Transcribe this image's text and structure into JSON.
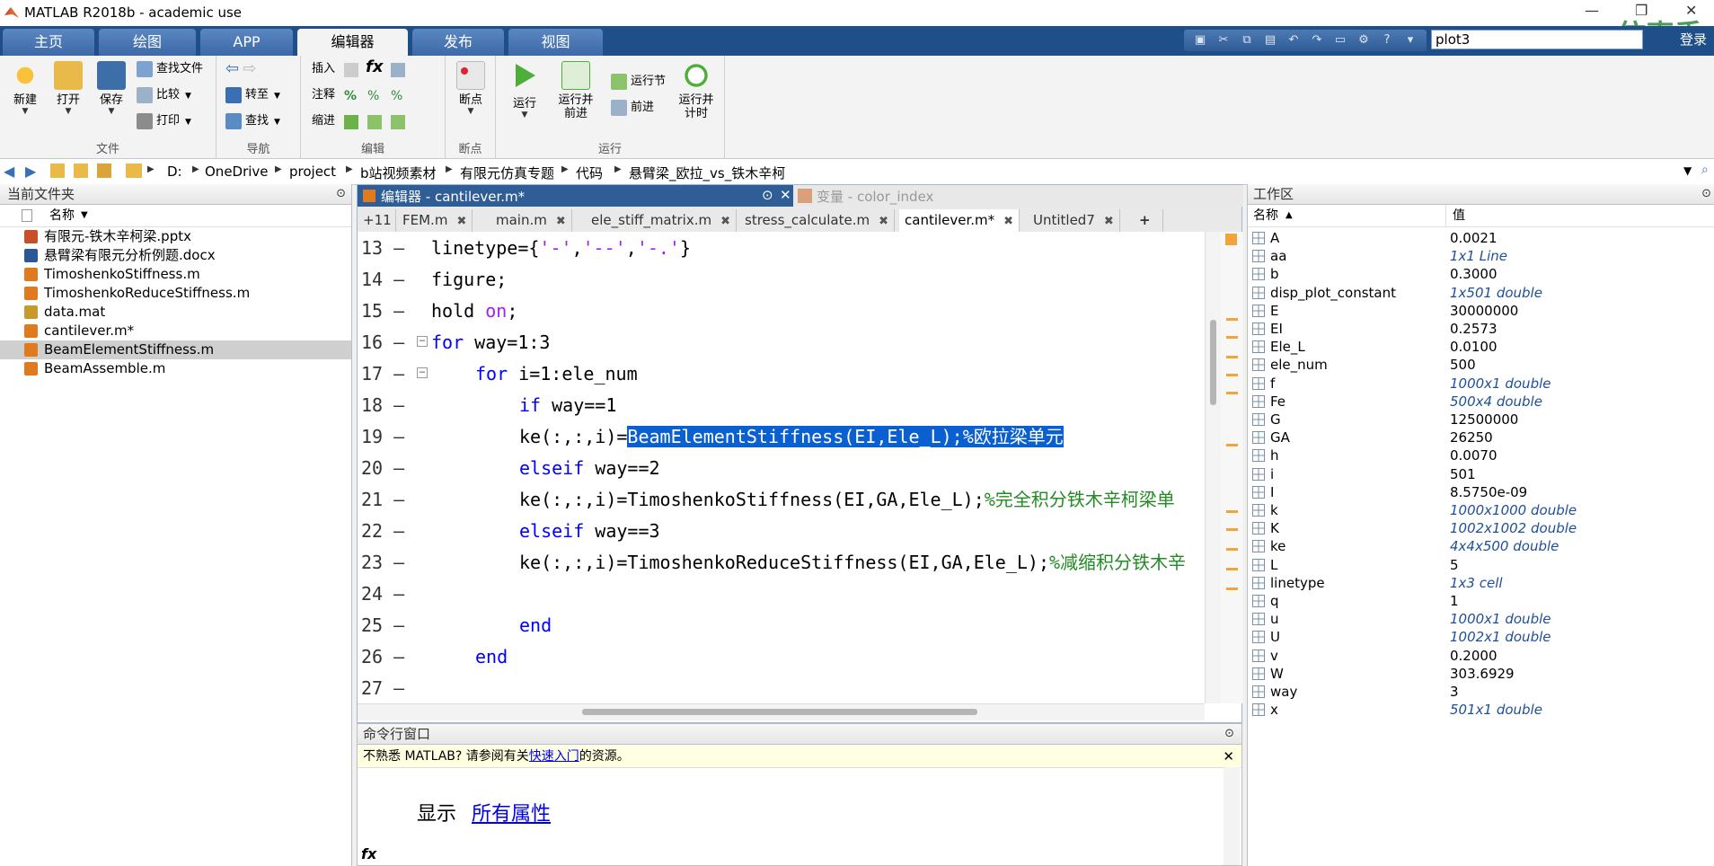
{
  "window": {
    "title": "MATLAB R2018b - academic use"
  },
  "ribbon": {
    "tabs": [
      {
        "label": "主页"
      },
      {
        "label": "绘图"
      },
      {
        "label": "APP"
      },
      {
        "label": "编辑器"
      },
      {
        "label": "发布"
      },
      {
        "label": "视图"
      }
    ],
    "search_value": "plot3",
    "login_label": "登录",
    "sections": {
      "file": {
        "label": "文件",
        "new": "新建",
        "open": "打开",
        "save": "保存",
        "find_file": "查找文件",
        "compare": "比较",
        "print": "打印"
      },
      "nav": {
        "label": "导航",
        "goto": "转至",
        "find": "查找"
      },
      "edit": {
        "label": "编辑",
        "insert": "插入",
        "comment": "注释",
        "indent": "缩进",
        "fx": "fx"
      },
      "breakpoint": {
        "label": "断点",
        "bp": "断点"
      },
      "run": {
        "label": "运行",
        "run": "运行",
        "run_advance": "运行并\n前进",
        "run_section": "运行节",
        "advance": "前进",
        "run_time": "运行并\n计时"
      }
    }
  },
  "address": {
    "crumbs": [
      "D:",
      "OneDrive",
      "project",
      "b站视频素材",
      "有限元仿真专题",
      "代码",
      "悬臂梁_欧拉_vs_铁木辛柯"
    ]
  },
  "current_folder": {
    "title": "当前文件夹",
    "column": "名称",
    "files": [
      {
        "name": "有限元-铁木辛柯梁.pptx",
        "icon": "pptx",
        "color": "#c94f2a"
      },
      {
        "name": "悬臂梁有限元分析例题.docx",
        "icon": "docx",
        "color": "#2b5797"
      },
      {
        "name": "TimoshenkoStiffness.m",
        "icon": "m",
        "color": "#e07a1f"
      },
      {
        "name": "TimoshenkoReduceStiffness.m",
        "icon": "m",
        "color": "#e07a1f"
      },
      {
        "name": "data.mat",
        "icon": "mat",
        "color": "#c79a2b"
      },
      {
        "name": "cantilever.m*",
        "icon": "m",
        "color": "#e07a1f"
      },
      {
        "name": "BeamElementStiffness.m",
        "icon": "m",
        "color": "#e07a1f",
        "selected": true
      },
      {
        "name": "BeamAssemble.m",
        "icon": "m",
        "color": "#e07a1f"
      }
    ]
  },
  "editor": {
    "title": "编辑器 - cantilever.m*",
    "var_title": "变量 - color_index",
    "overflow_tab": "+11",
    "tabs": [
      {
        "label": "FEM.m"
      },
      {
        "label": "main.m"
      },
      {
        "label": "ele_stiff_matrix.m"
      },
      {
        "label": "stress_calculate.m"
      },
      {
        "label": "cantilever.m*",
        "active": true
      },
      {
        "label": "Untitled7"
      }
    ],
    "lines": [
      {
        "num": "13",
        "parts": [
          {
            "t": "linetype={",
            "c": ""
          },
          {
            "t": "'-'",
            "c": "st"
          },
          {
            "t": ",",
            "c": ""
          },
          {
            "t": "'--'",
            "c": "st"
          },
          {
            "t": ",",
            "c": ""
          },
          {
            "t": "'-.'",
            "c": "st"
          },
          {
            "t": "}",
            "c": ""
          }
        ],
        "indent": 0
      },
      {
        "num": "14",
        "parts": [
          {
            "t": "figure;",
            "c": ""
          }
        ],
        "indent": 0
      },
      {
        "num": "15",
        "parts": [
          {
            "t": "hold ",
            "c": ""
          },
          {
            "t": "on",
            "c": "st"
          },
          {
            "t": ";",
            "c": ""
          }
        ],
        "indent": 0
      },
      {
        "num": "16",
        "parts": [
          {
            "t": "for",
            "c": "kw"
          },
          {
            "t": " way=1:3",
            "c": ""
          }
        ],
        "indent": 0,
        "fold": true
      },
      {
        "num": "17",
        "parts": [
          {
            "t": "for",
            "c": "kw"
          },
          {
            "t": " i=1:ele_num",
            "c": ""
          }
        ],
        "indent": 1,
        "fold": true
      },
      {
        "num": "18",
        "parts": [
          {
            "t": "if",
            "c": "kw"
          },
          {
            "t": " way==1",
            "c": ""
          }
        ],
        "indent": 2
      },
      {
        "num": "19",
        "parts": [
          {
            "t": "ke(:,:,i)=",
            "c": ""
          },
          {
            "t": "BeamElementStiffness(EI,Ele_L);%欧拉梁单元",
            "c": "hl"
          }
        ],
        "indent": 2
      },
      {
        "num": "20",
        "parts": [
          {
            "t": "elseif",
            "c": "kw"
          },
          {
            "t": " way==2",
            "c": ""
          }
        ],
        "indent": 2
      },
      {
        "num": "21",
        "parts": [
          {
            "t": "ke(:,:,i)=TimoshenkoStiffness(EI,GA,Ele_L);",
            "c": ""
          },
          {
            "t": "%完全积分铁木辛柯梁单",
            "c": "cm"
          }
        ],
        "indent": 2
      },
      {
        "num": "22",
        "parts": [
          {
            "t": "elseif",
            "c": "kw"
          },
          {
            "t": " way==3",
            "c": ""
          }
        ],
        "indent": 2
      },
      {
        "num": "23",
        "parts": [
          {
            "t": "ke(:,:,i)=TimoshenkoReduceStiffness(EI,GA,Ele_L);",
            "c": ""
          },
          {
            "t": "%减缩积分铁木辛",
            "c": "cm"
          }
        ],
        "indent": 2
      },
      {
        "num": "24",
        "parts": [],
        "indent": 2
      },
      {
        "num": "25",
        "parts": [
          {
            "t": "end",
            "c": "kw"
          }
        ],
        "indent": 2
      },
      {
        "num": "26",
        "parts": [
          {
            "t": "end",
            "c": "kw"
          }
        ],
        "indent": 1
      },
      {
        "num": "27",
        "parts": [],
        "indent": 0
      }
    ]
  },
  "command_window": {
    "title": "命令行窗口",
    "notice_prefix": "不熟悉 MATLAB? 请参阅有关",
    "notice_link": "快速入门",
    "notice_suffix": "的资源。",
    "display_label": "显示",
    "display_link": "所有属性",
    "prompt": "fx"
  },
  "workspace": {
    "title": "工作区",
    "col_name": "名称",
    "col_value": "值",
    "vars": [
      {
        "name": "A",
        "value": "0.0021"
      },
      {
        "name": "aa",
        "value": "1x1 Line",
        "italic": true
      },
      {
        "name": "b",
        "value": "0.3000"
      },
      {
        "name": "disp_plot_constant",
        "value": "1x501 double",
        "italic": true
      },
      {
        "name": "E",
        "value": "30000000"
      },
      {
        "name": "EI",
        "value": "0.2573"
      },
      {
        "name": "Ele_L",
        "value": "0.0100"
      },
      {
        "name": "ele_num",
        "value": "500"
      },
      {
        "name": "f",
        "value": "1000x1 double",
        "italic": true
      },
      {
        "name": "Fe",
        "value": "500x4 double",
        "italic": true
      },
      {
        "name": "G",
        "value": "12500000"
      },
      {
        "name": "GA",
        "value": "26250"
      },
      {
        "name": "h",
        "value": "0.0070"
      },
      {
        "name": "i",
        "value": "501"
      },
      {
        "name": "I",
        "value": "8.5750e-09"
      },
      {
        "name": "k",
        "value": "1000x1000 double",
        "italic": true
      },
      {
        "name": "K",
        "value": "1002x1002 double",
        "italic": true
      },
      {
        "name": "ke",
        "value": "4x4x500 double",
        "italic": true
      },
      {
        "name": "L",
        "value": "5"
      },
      {
        "name": "linetype",
        "value": "1x3 cell",
        "italic": true
      },
      {
        "name": "q",
        "value": "1"
      },
      {
        "name": "u",
        "value": "1000x1 double",
        "italic": true
      },
      {
        "name": "U",
        "value": "1002x1 double",
        "italic": true
      },
      {
        "name": "v",
        "value": "0.2000"
      },
      {
        "name": "W",
        "value": "303.6929"
      },
      {
        "name": "way",
        "value": "3"
      },
      {
        "name": "x",
        "value": "501x1 double",
        "italic": true
      }
    ]
  },
  "watermark": "仿真秀"
}
